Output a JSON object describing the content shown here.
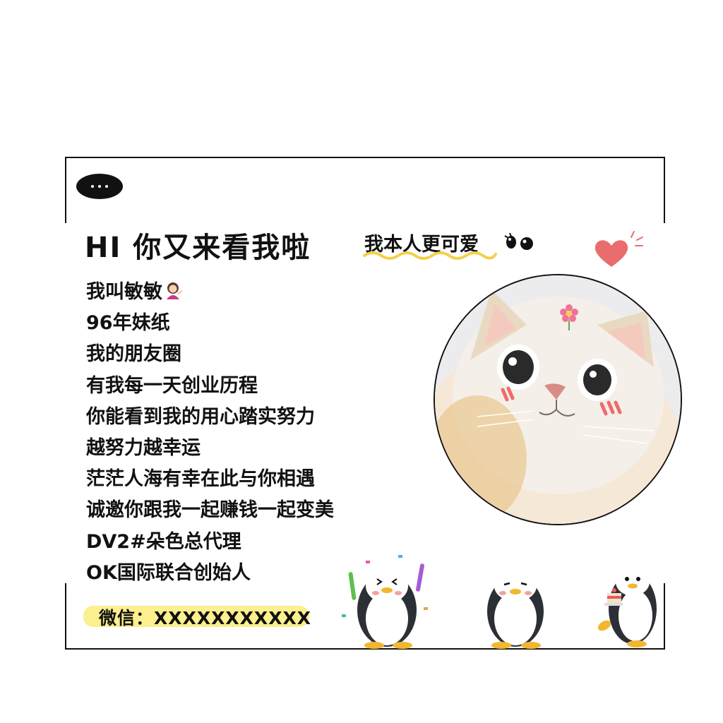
{
  "header": {
    "greeting": "HI 你又来看我啦",
    "tagline": "我本人更可爱"
  },
  "intro_lines": [
    "我叫敏敏",
    "96年妹纸",
    "我的朋友圈",
    "有我每一天创业历程",
    "你能看到我的用心踏实努力",
    "越努力越幸运",
    "茫茫人海有幸在此与你相遇",
    "诚邀你跟我一起赚钱一起变美",
    "DV2#朵色总代理",
    "OK国际联合创始人"
  ],
  "contact": {
    "wechat": "微信：XXXXXXXXXXX"
  },
  "icons": [
    "speech-bubble-icon",
    "eyes-icon",
    "heart-icon",
    "woman-tipping-hand-emoji"
  ],
  "colors": {
    "frame": "#111111",
    "highlight": "#fbef8e",
    "wave": "#f4cf4a",
    "heart": "#ea6d6d"
  }
}
